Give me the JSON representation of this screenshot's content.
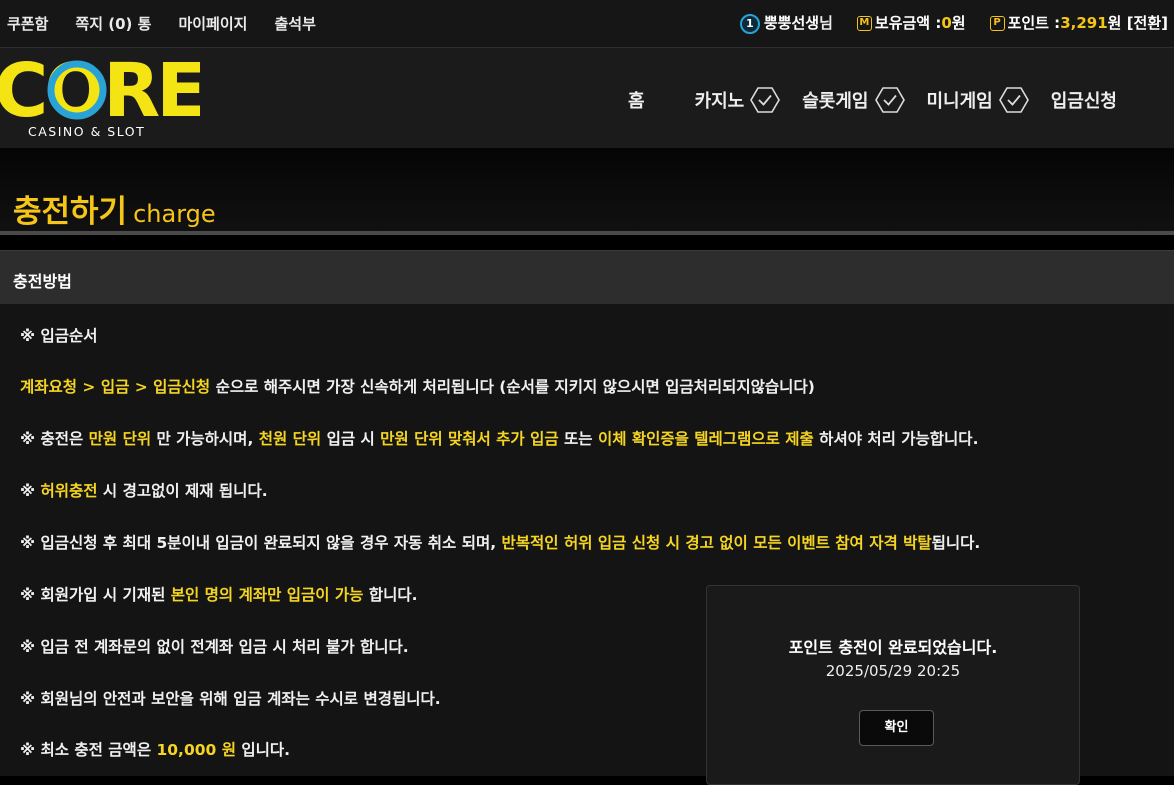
{
  "topbar": {
    "links": [
      "쿠폰함",
      "쪽지",
      "마이페이지",
      "출석부"
    ],
    "message_count_label": "(0)",
    "message_suffix": "통",
    "rank_number": "1",
    "username": "뿡뿡선생",
    "username_suffix": "님",
    "balance_label": "보유금액 :",
    "balance_value": "0",
    "balance_unit": "원",
    "points_label": "포인트 :",
    "points_value": "3,291",
    "points_unit": "원",
    "convert_label": "[전환]"
  },
  "logo": {
    "main": "CORE",
    "sub": "CASINO & SLOT"
  },
  "nav": [
    {
      "label": "홈",
      "has_check": false
    },
    {
      "label": "카지노",
      "has_check": true
    },
    {
      "label": "슬롯게임",
      "has_check": true
    },
    {
      "label": "미니게임",
      "has_check": true
    },
    {
      "label": "입금신청",
      "has_check": false
    }
  ],
  "page": {
    "title_ko": "충전하기",
    "title_en": "charge",
    "section_title": "충전방법"
  },
  "rules": [
    [
      {
        "t": "※ 입금순서",
        "h": false
      }
    ],
    [
      {
        "t": "계좌요청 > 입금 > 입금신청",
        "h": true
      },
      {
        "t": " 순으로 해주시면 가장 신속하게 처리됩니다 (순서를 지키지 않으시면 입금처리되지않습니다)",
        "h": false
      }
    ],
    [
      {
        "t": "※ 충전은 ",
        "h": false
      },
      {
        "t": "만원 단위",
        "h": true
      },
      {
        "t": " 만 가능하시며, ",
        "h": false
      },
      {
        "t": "천원 단위",
        "h": true
      },
      {
        "t": " 입금 시 ",
        "h": false
      },
      {
        "t": "만원 단위 맞춰서 추가 입금",
        "h": true
      },
      {
        "t": " 또는 ",
        "h": false
      },
      {
        "t": "이체 확인증을 텔레그램으로 제출",
        "h": true
      },
      {
        "t": " 하셔야 처리 가능합니다.",
        "h": false
      }
    ],
    [
      {
        "t": "※ ",
        "h": false
      },
      {
        "t": "허위충전",
        "h": true
      },
      {
        "t": " 시 경고없이 제재 됩니다.",
        "h": false
      }
    ],
    [
      {
        "t": "※ 입금신청 후 최대 5분이내 입금이 완료되지 않을 경우 자동 취소 되며, ",
        "h": false
      },
      {
        "t": "반복적인 허위 입금 신청 시 경고 없이 모든 이벤트 참여 자격 박탈",
        "h": true
      },
      {
        "t": "됩니다.",
        "h": false
      }
    ],
    [
      {
        "t": "※ 회원가입 시 기재된 ",
        "h": false
      },
      {
        "t": "본인 명의 계좌만 입금이 가능",
        "h": true
      },
      {
        "t": " 합니다.",
        "h": false
      }
    ],
    [
      {
        "t": "※ 입금 전 계좌문의 없이 전계좌 입금 시 처리 불가 합니다.",
        "h": false
      }
    ],
    [
      {
        "t": "※ 회원님의 안전과 보안을 위해 입금 계좌는 수시로 변경됩니다.",
        "h": false
      }
    ],
    [
      {
        "t": "※ 최소 충전 금액은 ",
        "h": false
      },
      {
        "t": "10,000 원",
        "h": true
      },
      {
        "t": " 입니다.",
        "h": false
      }
    ]
  ],
  "modal": {
    "message": "포인트 충전이 완료되었습니다.",
    "datetime": "2025/05/29 20:25",
    "confirm_label": "확인"
  },
  "colors": {
    "accent": "#f5c518",
    "highlight": "#f5d521",
    "logo_blue": "#29a3d6"
  }
}
